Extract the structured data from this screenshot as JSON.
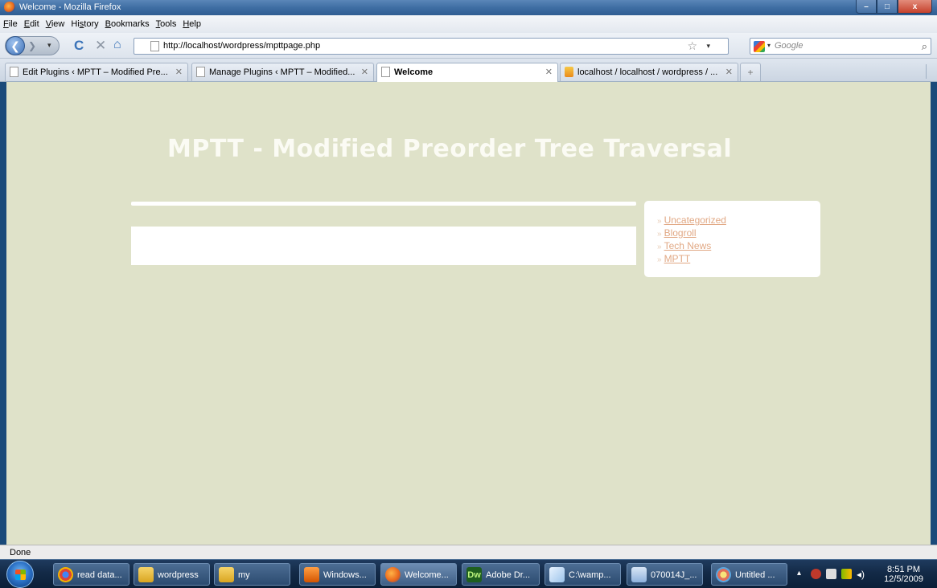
{
  "window": {
    "title": "Welcome - Mozilla Firefox",
    "min_label": "–",
    "max_label": "□",
    "close_label": "x"
  },
  "menu": [
    "File",
    "Edit",
    "View",
    "History",
    "Bookmarks",
    "Tools",
    "Help"
  ],
  "menu_underlines": [
    "F",
    "E",
    "V",
    "s",
    "B",
    "T",
    "H"
  ],
  "nav": {
    "back_glyph": "❮",
    "forward_glyph": "❯",
    "history_glyph": "▾",
    "reload_glyph": "C",
    "stop_glyph": "✕",
    "home_glyph": "⌂",
    "url": "http://localhost/wordpress/mpttpage.php",
    "bookmark_glyph": "☆",
    "dropdown_glyph": "▾",
    "search_placeholder": "Google",
    "search_glyph": "⌕",
    "search_engine_drop": "▾"
  },
  "tabs": [
    {
      "label": "Edit Plugins ‹ MPTT – Modified Pre...",
      "active": false,
      "icon": "page-icon"
    },
    {
      "label": "Manage Plugins ‹ MPTT – Modified...",
      "active": false,
      "icon": "page-icon"
    },
    {
      "label": "Welcome",
      "active": true,
      "icon": "page-icon"
    },
    {
      "label": "localhost / localhost / wordpress / ...",
      "active": false,
      "icon": "phpmyadmin-icon"
    }
  ],
  "tab_close_glyph": "✕",
  "newtab_glyph": "+",
  "page": {
    "site_title": "MPTT - Modified Preorder Tree Traversal",
    "sidebar_links": [
      "Uncategorized",
      "Blogroll",
      "Tech News",
      "MPTT"
    ],
    "bullet_glyph": "»"
  },
  "status": {
    "text": "Done"
  },
  "taskbar": {
    "items": [
      {
        "label": "read data...",
        "icon": "chrome-icon",
        "active": false
      },
      {
        "label": "wordpress",
        "icon": "folder-icon",
        "active": false
      },
      {
        "label": "my",
        "icon": "folder-icon",
        "active": false
      },
      {
        "label": "Windows...",
        "icon": "media-player-icon",
        "active": false
      },
      {
        "label": "Welcome...",
        "icon": "firefox-icon",
        "active": true
      },
      {
        "label": "Adobe Dr...",
        "icon": "dreamweaver-icon",
        "active": false
      },
      {
        "label": "C:\\wamp...",
        "icon": "notepad-icon",
        "active": false
      },
      {
        "label": "070014J_...",
        "icon": "word-icon",
        "active": false
      },
      {
        "label": "Untitled ...",
        "icon": "paint-icon",
        "active": false
      }
    ],
    "dw_text": "Dw",
    "tray_arrow": "▴",
    "volume_glyph": "◂)",
    "time": "8:51 PM",
    "date": "12/5/2009"
  },
  "colors": {
    "page_background": "#dfe2c9",
    "site_title": "#fbfbf4",
    "sidebar_link": "#e1a884"
  }
}
